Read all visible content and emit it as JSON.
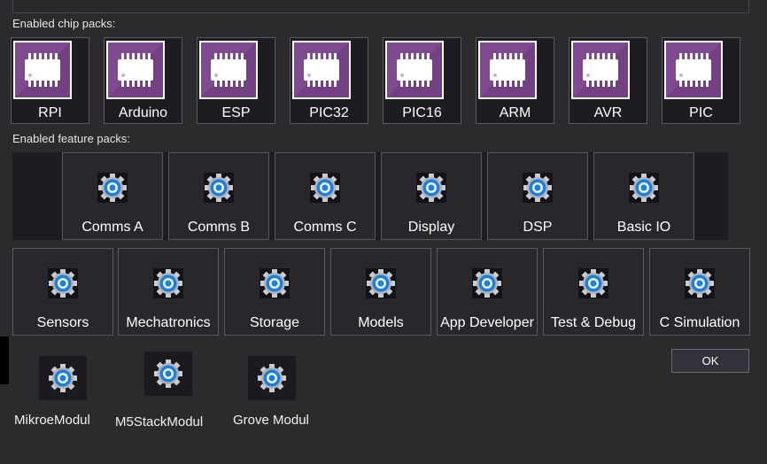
{
  "dialog": {
    "chip_section_label": "Enabled chip packs:",
    "feature_section_label": "Enabled feature packs:",
    "ok_label": "OK"
  },
  "chip_packs": [
    {
      "label": "RPI"
    },
    {
      "label": "Arduino"
    },
    {
      "label": "ESP"
    },
    {
      "label": "PIC32"
    },
    {
      "label": "PIC16"
    },
    {
      "label": "ARM"
    },
    {
      "label": "AVR"
    },
    {
      "label": "PIC"
    }
  ],
  "feature_packs_row1": [
    {
      "label": "Comms A"
    },
    {
      "label": "Comms B"
    },
    {
      "label": "Comms C"
    },
    {
      "label": "Display"
    },
    {
      "label": "DSP"
    },
    {
      "label": "Basic IO"
    }
  ],
  "feature_packs_row2": [
    {
      "label": "Sensors"
    },
    {
      "label": "Mechatronics"
    },
    {
      "label": "Storage"
    },
    {
      "label": "Models"
    },
    {
      "label": "App Developer"
    },
    {
      "label": "Test & Debug"
    },
    {
      "label": "C Simulation"
    }
  ],
  "modules": [
    {
      "label": "MikroeModul"
    },
    {
      "label": "M5StackModul"
    },
    {
      "label": "Grove Modul"
    }
  ],
  "colors": {
    "background": "#2d2a2e",
    "chip_icon": "#7f4a8f",
    "gear_blue": "#1f7fd6",
    "tile": "#2a272c"
  },
  "icons": {
    "chip_pack": "chip-icon",
    "feature_pack": "gear-icon",
    "module": "gear-icon"
  }
}
